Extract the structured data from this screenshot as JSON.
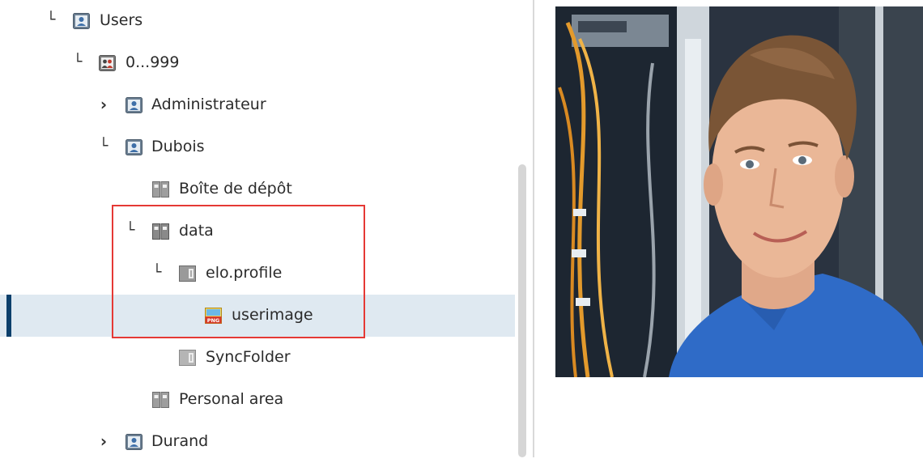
{
  "tree": {
    "nodes": [
      {
        "label": "Users",
        "toggle": "expanded",
        "icon": "user-folder-icon"
      },
      {
        "label": "0...999",
        "toggle": "expanded",
        "icon": "user-group-folder-icon"
      },
      {
        "label": "Administrateur",
        "toggle": "collapsed",
        "icon": "user-folder-icon"
      },
      {
        "label": "Dubois",
        "toggle": "expanded",
        "icon": "user-folder-icon"
      },
      {
        "label": "Boîte de dépôt",
        "toggle": "none",
        "icon": "binder-icon"
      },
      {
        "label": "data",
        "toggle": "expanded",
        "icon": "binder-icon"
      },
      {
        "label": "elo.profile",
        "toggle": "expanded",
        "icon": "folder-icon"
      },
      {
        "label": "userimage",
        "toggle": "none",
        "icon": "png-file-icon",
        "selected": true
      },
      {
        "label": "SyncFolder",
        "toggle": "none",
        "icon": "folder-icon"
      },
      {
        "label": "Personal area",
        "toggle": "none",
        "icon": "binder-icon"
      },
      {
        "label": "Durand",
        "toggle": "collapsed",
        "icon": "user-folder-icon"
      }
    ]
  },
  "preview": {
    "content": "portrait-photo"
  },
  "colors": {
    "selection": "#dfe9f1",
    "selection_marker": "#0b3f6b",
    "highlight": "#e53935"
  }
}
